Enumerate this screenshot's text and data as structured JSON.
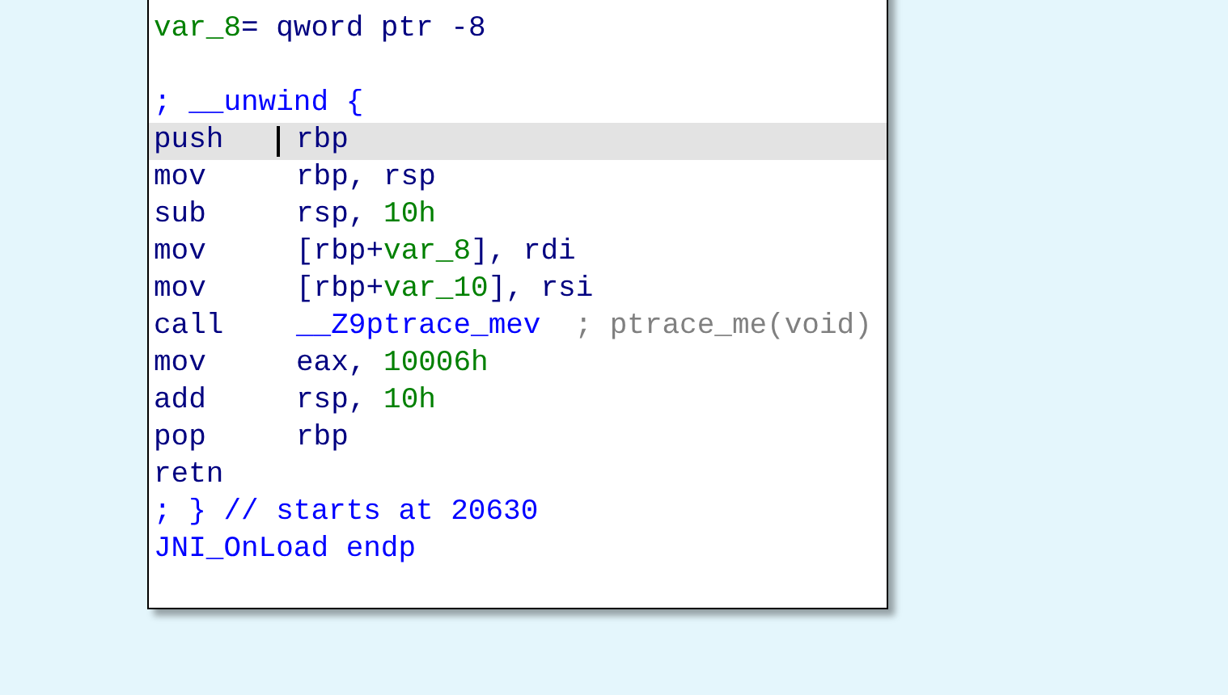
{
  "lines": [
    {
      "kind": "text",
      "selected": false,
      "tokens": [
        {
          "kind": "var",
          "text": "var_8"
        },
        {
          "kind": "plain",
          "text": "= qword ptr -8"
        }
      ]
    },
    {
      "kind": "blank"
    },
    {
      "kind": "text",
      "selected": false,
      "tokens": [
        {
          "kind": "name",
          "text": "; __unwind {"
        }
      ]
    },
    {
      "kind": "instruction",
      "selected": true,
      "mnemonic": "push",
      "tokens": [
        {
          "kind": "plain",
          "text": "rbp"
        }
      ]
    },
    {
      "kind": "instruction",
      "selected": false,
      "mnemonic": "mov",
      "tokens": [
        {
          "kind": "plain",
          "text": "rbp, rsp"
        }
      ]
    },
    {
      "kind": "instruction",
      "selected": false,
      "mnemonic": "sub",
      "tokens": [
        {
          "kind": "plain",
          "text": "rsp, "
        },
        {
          "kind": "number",
          "text": "10h"
        }
      ]
    },
    {
      "kind": "instruction",
      "selected": false,
      "mnemonic": "mov",
      "tokens": [
        {
          "kind": "plain",
          "text": "[rbp+"
        },
        {
          "kind": "var",
          "text": "var_8"
        },
        {
          "kind": "plain",
          "text": "], rdi"
        }
      ]
    },
    {
      "kind": "instruction",
      "selected": false,
      "mnemonic": "mov",
      "tokens": [
        {
          "kind": "plain",
          "text": "[rbp+"
        },
        {
          "kind": "var",
          "text": "var_10"
        },
        {
          "kind": "plain",
          "text": "], rsi"
        }
      ]
    },
    {
      "kind": "instruction",
      "selected": false,
      "mnemonic": "call",
      "tokens": [
        {
          "kind": "name",
          "text": "__Z9ptrace_mev"
        }
      ],
      "comment": "; ptrace_me(void)"
    },
    {
      "kind": "instruction",
      "selected": false,
      "mnemonic": "mov",
      "tokens": [
        {
          "kind": "plain",
          "text": "eax, "
        },
        {
          "kind": "number",
          "text": "10006h"
        }
      ]
    },
    {
      "kind": "instruction",
      "selected": false,
      "mnemonic": "add",
      "tokens": [
        {
          "kind": "plain",
          "text": "rsp, "
        },
        {
          "kind": "number",
          "text": "10h"
        }
      ]
    },
    {
      "kind": "instruction",
      "selected": false,
      "mnemonic": "pop",
      "tokens": [
        {
          "kind": "plain",
          "text": "rbp"
        }
      ]
    },
    {
      "kind": "instruction",
      "selected": false,
      "mnemonic": "retn"
    },
    {
      "kind": "text",
      "selected": false,
      "tokens": [
        {
          "kind": "name",
          "text": "; } // starts at 20630"
        }
      ]
    },
    {
      "kind": "text",
      "selected": false,
      "tokens": [
        {
          "kind": "name",
          "text": "JNI_OnLoad endp"
        }
      ]
    }
  ]
}
